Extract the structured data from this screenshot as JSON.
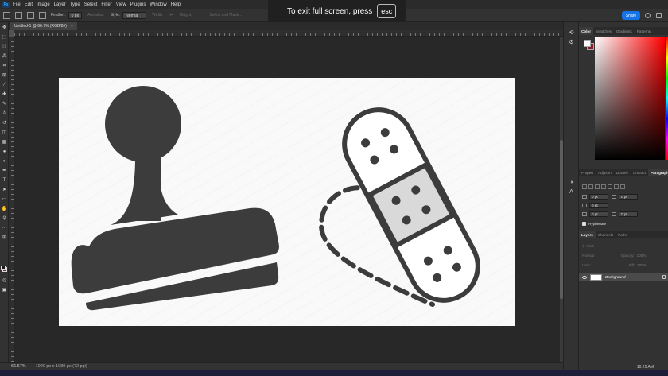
{
  "app": {
    "logo": "Ps"
  },
  "menu": [
    "File",
    "Edit",
    "Image",
    "Layer",
    "Type",
    "Select",
    "Filter",
    "View",
    "Plugins",
    "Window",
    "Help"
  ],
  "fullscreen_notice": {
    "text": "To exit full screen, press",
    "key": "esc"
  },
  "options_bar": {
    "feather_label": "Feather:",
    "feather_value": "0 px",
    "anti_alias_label": "Anti-alias",
    "style_label": "Style:",
    "style_value": "Normal",
    "width_label": "Width:",
    "height_label": "Height:",
    "select_mask_label": "Select and Mask...",
    "share_label": "Share"
  },
  "document_tab": {
    "title": "Untitled-1 @ 66.7% (RGB/8#)",
    "close": "×"
  },
  "status_bar": {
    "zoom": "66.67%",
    "info": "1920 px x 1080 px (72 ppi)"
  },
  "clock": "10:25 AM",
  "panels": {
    "color_tabs": [
      "Color",
      "Swatches",
      "Gradients",
      "Patterns"
    ],
    "properties_tabs": [
      "Propert",
      "Adjustm",
      "Librarie",
      "Charact",
      "Paragraph"
    ],
    "paragraph": {
      "fields": [
        "0 pt",
        "0 pt",
        "0 pt",
        "0 pt",
        "0 pt"
      ],
      "hyphenate_label": "Hyphenate"
    },
    "layers_tabs": [
      "Layers",
      "Channels",
      "Paths"
    ],
    "layers": {
      "kind_label": "Kind",
      "blend_mode": "Normal",
      "opacity_label": "Opacity:",
      "opacity_value": "100%",
      "lock_label": "Lock:",
      "fill_label": "Fill:",
      "fill_value": "100%",
      "items": [
        {
          "name": "Background"
        }
      ]
    }
  },
  "colors": {
    "artwork": "#3c3c3c",
    "bandage_pad": "#d9d9d9",
    "canvas_bg": "#282828",
    "share_button": "#1473e6"
  }
}
